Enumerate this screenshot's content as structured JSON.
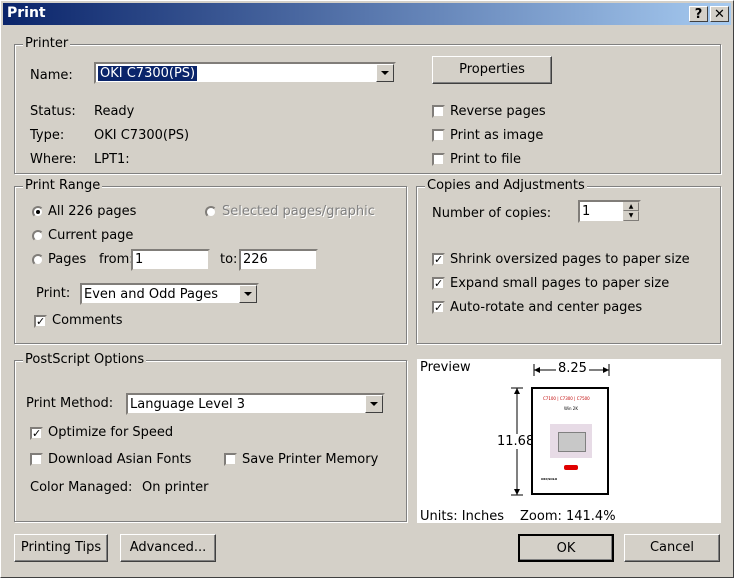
{
  "title": "Print",
  "title_help": "?",
  "title_close": "✕",
  "printer": {
    "group_label": "Printer",
    "name_label": "Name:",
    "name_value": "OKI C7300(PS)",
    "properties_btn": "Properties",
    "status_label": "Status:",
    "status_value": "Ready",
    "type_label": "Type:",
    "type_value": "OKI C7300(PS)",
    "where_label": "Where:",
    "where_value": "LPT1:",
    "reverse_pages": "Reverse pages",
    "print_as_image": "Print as image",
    "print_to_file": "Print to file"
  },
  "range": {
    "group_label": "Print Range",
    "all_pages": "All 226 pages",
    "selected": "Selected pages/graphic",
    "current_page": "Current page",
    "pages": "Pages",
    "from_label": "from:",
    "from_value": "1",
    "to_label": "to:",
    "to_value": "226",
    "print_label": "Print:",
    "print_value": "Even and Odd Pages",
    "comments": "Comments"
  },
  "copies": {
    "group_label": "Copies and Adjustments",
    "num_copies_label": "Number of copies:",
    "num_copies_value": "1",
    "shrink": "Shrink oversized pages to paper size",
    "expand": "Expand small pages to paper size",
    "autorotate": "Auto-rotate and center pages"
  },
  "postscript": {
    "group_label": "PostScript Options",
    "method_label": "Print Method:",
    "method_value": "Language Level 3",
    "optimize": "Optimize for Speed",
    "download_fonts": "Download Asian Fonts",
    "save_memory": "Save Printer Memory",
    "color_managed_label": "Color Managed:",
    "color_managed_value": "On printer"
  },
  "preview": {
    "label": "Preview",
    "width_dim": "8.25",
    "height_dim": "11.68",
    "units": "Units: Inches",
    "zoom": "Zoom: 141.4%",
    "page_header": "C7100 | C7300 | C7500",
    "page_sub": "Win 2K",
    "page_footer": "OKI/SOLO"
  },
  "buttons": {
    "printing_tips": "Printing Tips",
    "advanced": "Advanced...",
    "ok": "OK",
    "cancel": "Cancel"
  }
}
